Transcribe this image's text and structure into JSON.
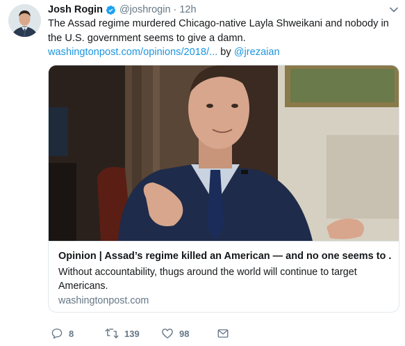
{
  "tweet": {
    "author_name": "Josh Rogin",
    "handle": "@joshrogin",
    "separator": "·",
    "time": "12h",
    "text_before": "The Assad regime murdered Chicago-native Layla Shweikani and nobody in the U.S. government seems to give a damn. ",
    "link_text": "washingtonpost.com/opinions/2018/...",
    "text_by": " by ",
    "mention": "@jrezaian"
  },
  "card": {
    "title": "Opinion | Assad’s regime killed an American — and no one seems to ...",
    "description": "Without accountability, thugs around the world will continue to target Americans.",
    "domain": "washingtonpost.com"
  },
  "actions": {
    "reply_count": "8",
    "retweet_count": "139",
    "like_count": "98",
    "reply_icon": "reply-icon",
    "retweet_icon": "retweet-icon",
    "like_icon": "heart-icon",
    "dm_icon": "envelope-icon"
  },
  "colors": {
    "link": "#1b95e0",
    "muted": "#657786",
    "text": "#14171a",
    "verified": "#1da1f2",
    "border": "#e1e8ed"
  }
}
